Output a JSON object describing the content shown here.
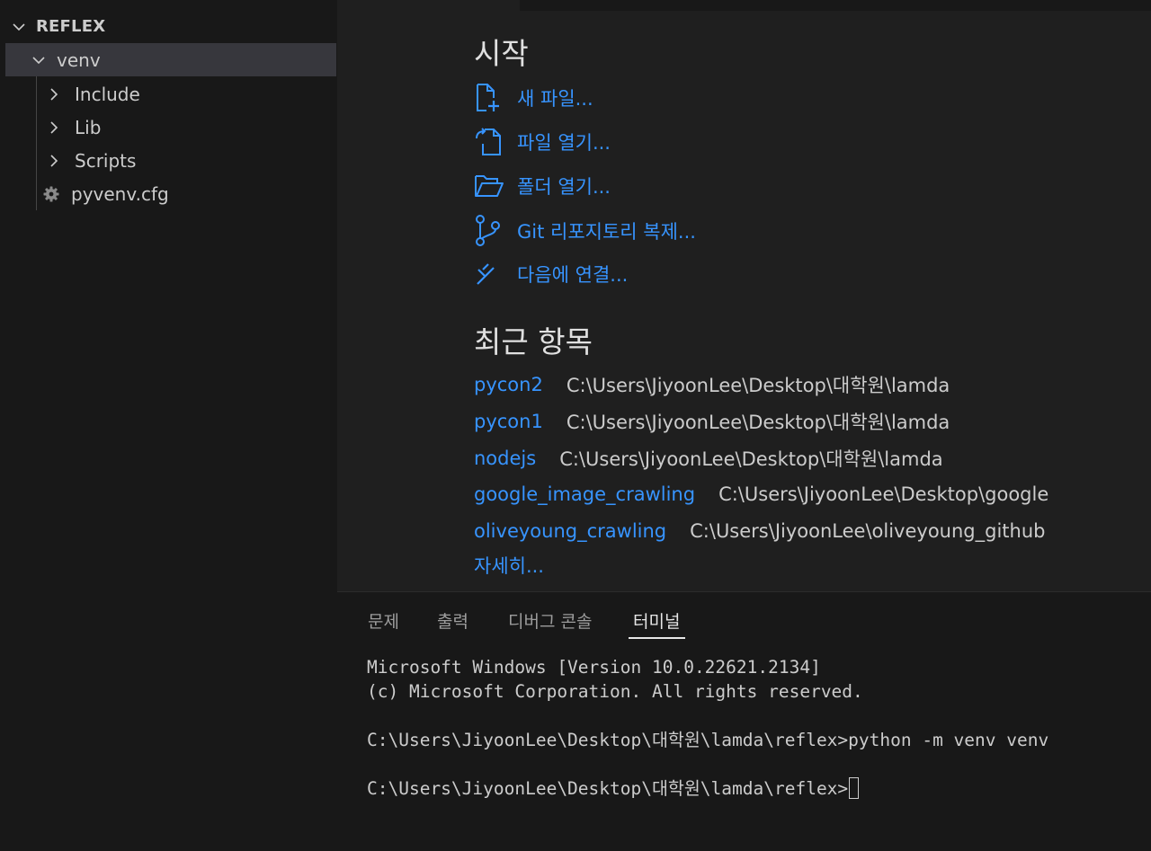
{
  "explorer": {
    "root_label": "REFLEX",
    "folder": "venv",
    "children": [
      "Include",
      "Lib",
      "Scripts"
    ],
    "file": "pyvenv.cfg"
  },
  "welcome": {
    "start_heading": "시작",
    "start_items": [
      {
        "label": "새 파일...",
        "icon": "new-file-icon"
      },
      {
        "label": "파일 열기...",
        "icon": "open-file-icon"
      },
      {
        "label": "폴더 열기...",
        "icon": "open-folder-icon"
      },
      {
        "label": "Git 리포지토리 복제...",
        "icon": "git-clone-icon"
      },
      {
        "label": "다음에 연결...",
        "icon": "remote-connect-icon"
      }
    ],
    "recent_heading": "최근 항목",
    "recent": [
      {
        "name": "pycon2",
        "path": "C:\\Users\\JiyoonLee\\Desktop\\대학원\\lamda"
      },
      {
        "name": "pycon1",
        "path": "C:\\Users\\JiyoonLee\\Desktop\\대학원\\lamda"
      },
      {
        "name": "nodejs",
        "path": "C:\\Users\\JiyoonLee\\Desktop\\대학원\\lamda"
      },
      {
        "name": "google_image_crawling",
        "path": "C:\\Users\\JiyoonLee\\Desktop\\google"
      },
      {
        "name": "oliveyoung_crawling",
        "path": "C:\\Users\\JiyoonLee\\oliveyoung_github"
      }
    ],
    "more_label": "자세히..."
  },
  "panel": {
    "tabs": [
      "문제",
      "출력",
      "디버그 콘솔",
      "터미널"
    ],
    "active_tab": "터미널",
    "terminal_lines": [
      "Microsoft Windows [Version 10.0.22621.2134]",
      "(c) Microsoft Corporation. All rights reserved.",
      "",
      "C:\\Users\\JiyoonLee\\Desktop\\대학원\\lamda\\reflex>python -m venv venv",
      "",
      "C:\\Users\\JiyoonLee\\Desktop\\대학원\\lamda\\reflex>"
    ]
  },
  "colors": {
    "link": "#3794ff",
    "sidebar_bg": "#181818",
    "editor_bg": "#1f1f1f",
    "selection_bg": "#37373d"
  }
}
